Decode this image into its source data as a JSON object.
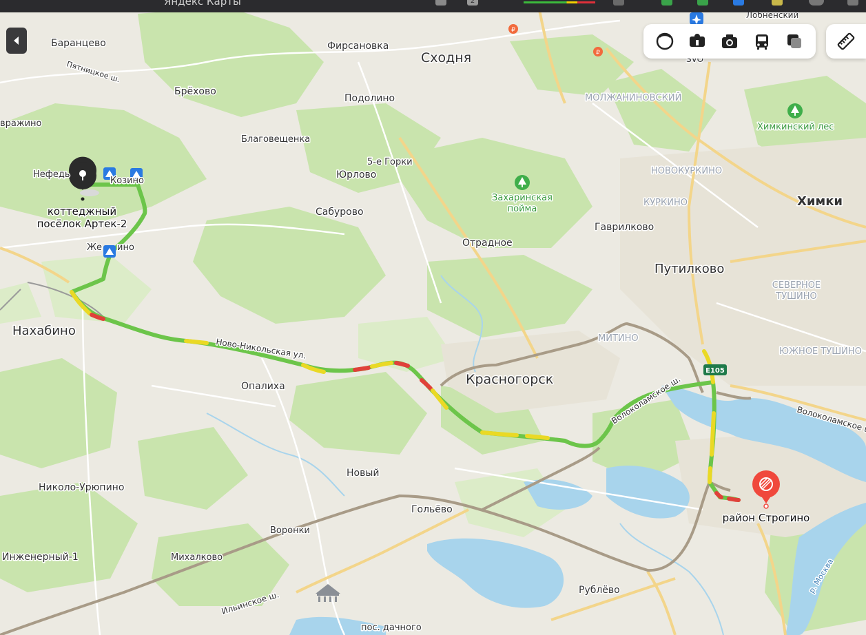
{
  "app": {
    "title": "Яндекс Карты",
    "tab_badge": "2"
  },
  "colors": {
    "land": "#eceae2",
    "forest": "#c6e3a8",
    "forest_light": "#d8ecc0",
    "water": "#a8d4ec",
    "highway": "#a89b87",
    "road_light": "#ffffff",
    "route_green": "#6cc54a",
    "route_yellow": "#ead925",
    "route_red": "#e0413a",
    "marker_dark": "#2b2b2b",
    "marker_end": "#f0483c"
  },
  "toolbar": {
    "collapse_icon": "chevron-left-icon",
    "layers": [
      {
        "name": "layers-icon"
      },
      {
        "name": "panorama-icon"
      },
      {
        "name": "camera-icon"
      },
      {
        "name": "transit-icon"
      },
      {
        "name": "copy-icon"
      }
    ],
    "ruler_icon": "ruler-icon"
  },
  "route": {
    "start_label_line1": "коттеджный",
    "start_label_line2": "посёлок Артек-2",
    "end_label": "район Строгино",
    "traffic": "mostly green with yellow and red segments"
  },
  "places": {
    "baranzevo": "Баранцево",
    "firsanovka": "Фирсановка",
    "skhodnya": "Сходня",
    "podolino": "Подолино",
    "brekhovo": "Брёхово",
    "pyatnitskoe": "Пятницкое ш.",
    "avrazhino": "вражино",
    "blagoveshchenka": "Благовещенка",
    "gorki": "5-е Горки",
    "yurlovo": "Юрлово",
    "nefedyevo": "Нефедь",
    "kozino": "Козино",
    "saburovo": "Сабурово",
    "zakharinskaya_1": "Захаринская",
    "zakharinskaya_2": "пойма",
    "molzhaninovsky": "МОЛЖАНИНОВСКИЙ",
    "khimkinsky_les": "Химкинский лес",
    "novokurkino": "НОВОКУРКИНО",
    "kurkino": "КУРКИНО",
    "khimki": "Химки",
    "gavrilkovo": "Гаврилково",
    "otradnoe": "Отрадное",
    "zhelebino": "Же",
    "zhelebino_end": "ино",
    "putilkovo": "Путилково",
    "severnoe_1": "СЕВЕРНОЕ",
    "severnoe_2": "ТУШИНО",
    "nakhabino": "Нахабино",
    "mitino": "МИТИНО",
    "yuzhnoe": "ЮЖНОЕ ТУШИНО",
    "novonikolskaya": "Ново-Никольская ул.",
    "krasnogorsk": "Красногорск",
    "e105": "E105",
    "opalikha": "Опалиха",
    "volokolamskoe_1": "Волоколамское ш.",
    "volokolamskoe_2": "Волоколамское ш.",
    "novy": "Новый",
    "nikolo": "Николо-Урюпино",
    "golyovo": "Гольёво",
    "voronki": "Воронки",
    "inzhenerny": "Инженерный-1",
    "mikhalkovo": "Михалково",
    "ilinskoe": "Ильинское ш.",
    "rublyovo": "Рублёво",
    "moskva_river": "р. Москва",
    "dachnogo": "пос. дачного",
    "lobnensky": "Лобненский",
    "svo": "SVO"
  }
}
